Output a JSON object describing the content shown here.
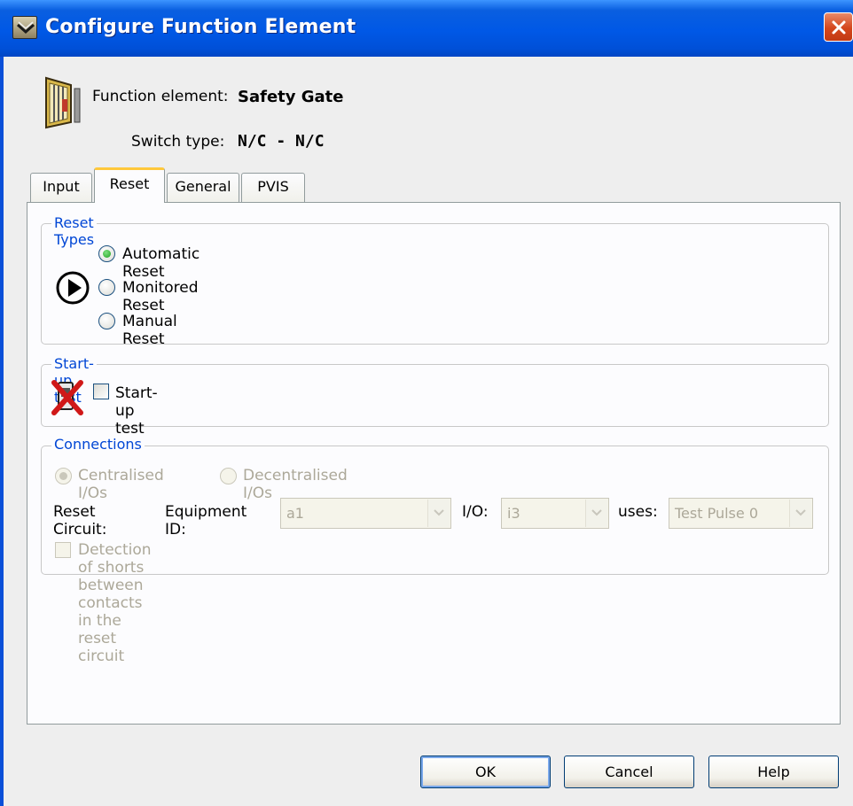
{
  "window": {
    "title": "Configure Function Element",
    "accent_color": "#0058e6",
    "close_color": "#d4461c"
  },
  "header": {
    "function_element_label": "Function element:",
    "function_element_value": "Safety Gate",
    "function_element_icon": "safety-gate-icon",
    "switch_type_label": "Switch type:",
    "switch_type_value": "N/C - N/C"
  },
  "tabs": [
    {
      "label": "Input",
      "active": false
    },
    {
      "label": "Reset",
      "active": true
    },
    {
      "label": "General",
      "active": false
    },
    {
      "label": "PVIS",
      "active": false
    }
  ],
  "reset_types": {
    "title": "Reset Types",
    "indicator_icon": "play-icon",
    "options": [
      {
        "label": "Automatic Reset",
        "checked": true
      },
      {
        "label": "Monitored Reset",
        "checked": false
      },
      {
        "label": "Manual Reset",
        "checked": false
      }
    ]
  },
  "startup_test": {
    "title": "Start-up test",
    "indicator_icon": "crossed-out-icon",
    "checkbox_label": "Start-up test",
    "checked": false
  },
  "connections": {
    "title": "Connections",
    "enabled": false,
    "io_options": [
      {
        "label": "Centralised I/Os",
        "checked": true
      },
      {
        "label": "Decentralised I/Os",
        "checked": false
      }
    ],
    "reset_circuit_label": "Reset Circuit:",
    "equipment_id_label": "Equipment ID:",
    "equipment_id_value": "a1",
    "io_label": "I/O:",
    "io_value": "i3",
    "uses_label": "uses:",
    "uses_value": "Test Pulse 0",
    "shorts_detection_label": "Detection of shorts between contacts in the reset circuit",
    "shorts_detection_checked": false
  },
  "buttons": {
    "ok": "OK",
    "cancel": "Cancel",
    "help": "Help"
  }
}
